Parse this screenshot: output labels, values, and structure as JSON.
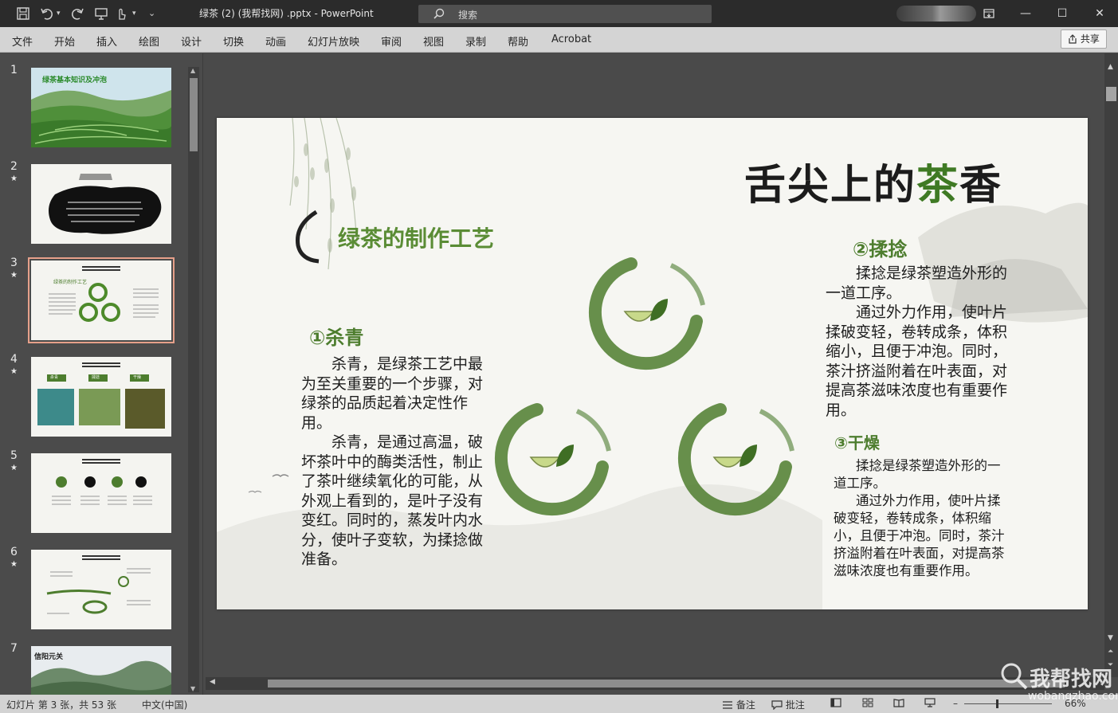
{
  "window": {
    "title": "绿茶 (2) (我帮找网) .pptx  -  PowerPoint",
    "search_placeholder": "搜索",
    "minimize": "—",
    "maximize": "☐",
    "close": "✕"
  },
  "menu": {
    "items": [
      "文件",
      "开始",
      "插入",
      "绘图",
      "设计",
      "切换",
      "动画",
      "幻灯片放映",
      "审阅",
      "视图",
      "录制",
      "帮助",
      "Acrobat"
    ],
    "share_label": "共享"
  },
  "thumbnails": [
    {
      "num": "1",
      "star": "",
      "title": "绿茶基本知识及冲泡"
    },
    {
      "num": "2",
      "star": "★",
      "title": ""
    },
    {
      "num": "3",
      "star": "★",
      "title": "绿茶的制作工艺"
    },
    {
      "num": "4",
      "star": "★",
      "title": "",
      "tags": [
        "杀青",
        "揉捻",
        "干燥"
      ]
    },
    {
      "num": "5",
      "star": "★",
      "title": ""
    },
    {
      "num": "6",
      "star": "★",
      "title": ""
    },
    {
      "num": "7",
      "star": "",
      "title": "信阳元关"
    }
  ],
  "slide": {
    "title_prefix": "舌尖上的",
    "title_cha": "茶",
    "title_suffix": "香",
    "heading": "绿茶的制作工艺",
    "sections": [
      {
        "title": "①杀青",
        "paragraphs": [
          "杀青，是绿茶工艺中最为至关重要的一个步骤，对绿茶的品质起着决定性作用。",
          "杀青，是通过高温，破坏茶叶中的酶类活性，制止了茶叶继续氧化的可能，从外观上看到的，是叶子没有变红。同时的，蒸发叶内水分，使叶子变软，为揉捻做准备。"
        ]
      },
      {
        "title": "②揉捻",
        "paragraphs": [
          "揉捻是绿茶塑造外形的一道工序。",
          "通过外力作用，使叶片揉破变轻，卷转成条，体积缩小，且便于冲泡。同时，茶汁挤溢附着在叶表面，对提高茶滋味浓度也有重要作用。"
        ]
      },
      {
        "title": "③干燥",
        "paragraphs": [
          "揉捻是绿茶塑造外形的一道工序。",
          "通过外力作用，使叶片揉破变轻，卷转成条，体积缩小，且便于冲泡。同时，茶汁挤溢附着在叶表面，对提高茶滋味浓度也有重要作用。"
        ]
      }
    ]
  },
  "status": {
    "slide_info": "幻灯片 第 3 张，共 53 张",
    "language": "中文(中国)",
    "notes": "备注",
    "comments": "批注",
    "zoom": "66%"
  },
  "watermark": {
    "name": "我帮找网",
    "url": "wobangzhao.com"
  },
  "colors": {
    "accent_green": "#4d7d2e",
    "titlebar": "#2b2b2b",
    "ribbon": "#d4d4d4"
  }
}
